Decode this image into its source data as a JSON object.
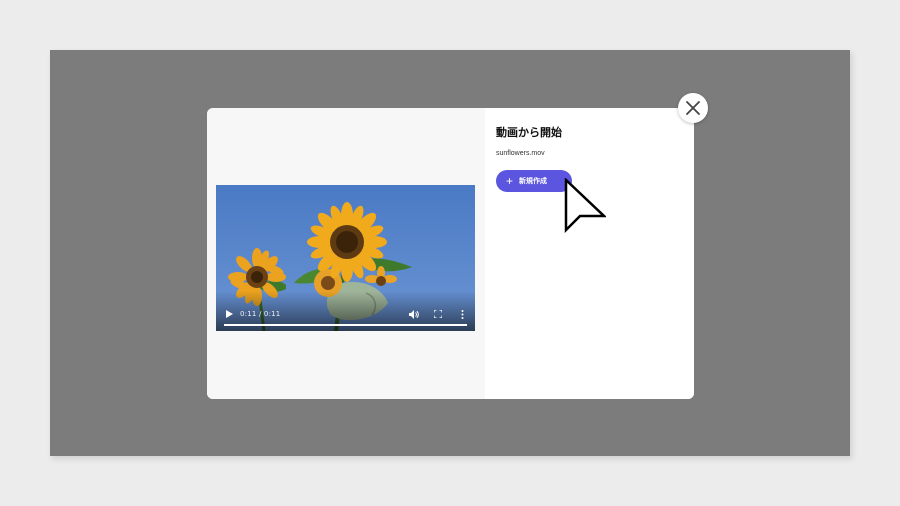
{
  "dialog": {
    "title": "動画から開始",
    "file_name": "sunflowers.mov",
    "create_button_label": "新規作成",
    "create_button_icon": "plus-icon",
    "close_icon": "close-icon"
  },
  "video_player": {
    "time_display": "0:11 / 0:11",
    "progress": 1.0,
    "icons": [
      "play-icon",
      "volume-icon",
      "fullscreen-icon",
      "more-options-icon"
    ]
  },
  "colors": {
    "overlay": "#7c7c7c",
    "accent": "#5b55e0",
    "sky": "#4f7fc4"
  }
}
